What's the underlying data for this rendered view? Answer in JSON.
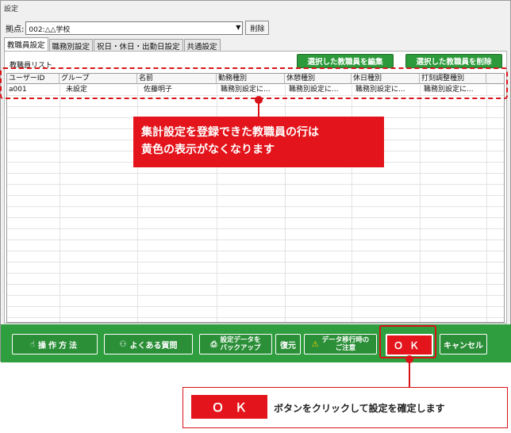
{
  "window": {
    "title": "設定"
  },
  "branch": {
    "label": "拠点:",
    "value": "002:△△学校",
    "delete_label": "削除"
  },
  "tabs": [
    {
      "label": "教職員設定"
    },
    {
      "label": "職務別設定"
    },
    {
      "label": "祝日・休日・出勤日設定"
    },
    {
      "label": "共通設定"
    }
  ],
  "list": {
    "label": "教職員リスト",
    "edit_button": "選択した教職員を編集",
    "delete_button": "選択した教職員を削除",
    "columns": [
      "ユーザーID",
      "グループ",
      "名前",
      "勤務種別",
      "休憩種別",
      "休日種別",
      "打刻調整種別"
    ],
    "rows": [
      [
        "a001",
        "未設定",
        "佐藤明子",
        "職務別設定に...",
        "職務別設定に...",
        "職務別設定に...",
        "職務別設定に..."
      ]
    ]
  },
  "callout": {
    "line1": "集計設定を登録できた教職員の行は",
    "line2": "黄色の表示がなくなります"
  },
  "bottom_bar": {
    "howto": "操作方法",
    "faq": "よくある質問",
    "backup_line1": "設定データを",
    "backup_line2": "バックアップ",
    "restore": "復元",
    "migration_line1": "データ移行時の",
    "migration_line2": "ご注意",
    "ok": "ＯＫ",
    "cancel": "キャンセル"
  },
  "note": {
    "ok": "ＯＫ",
    "text": "ボタンをクリックして設定を確定します"
  },
  "colors": {
    "accent_red": "#e3141b",
    "bar_green": "#2f9e3e"
  }
}
